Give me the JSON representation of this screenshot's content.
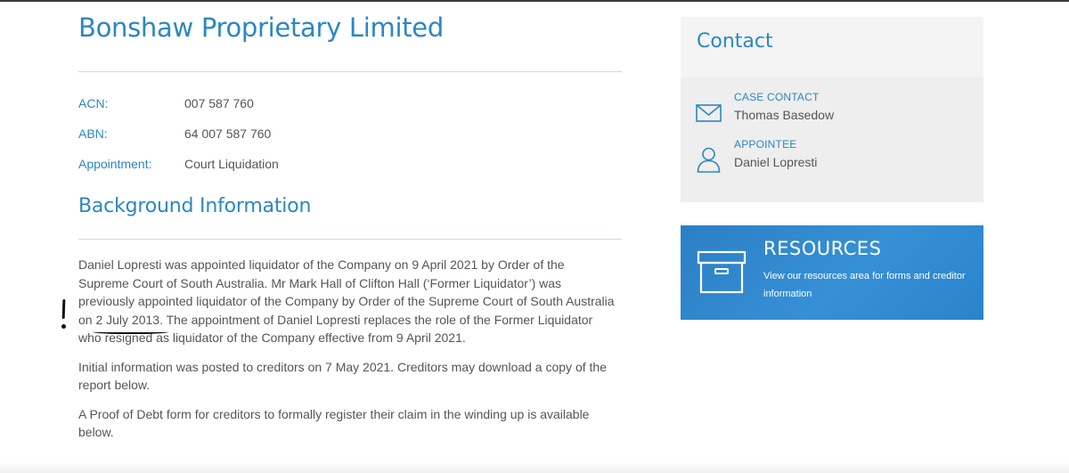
{
  "page": {
    "company_name": "Bonshaw Proprietary Limited",
    "details": [
      {
        "label": "ACN:",
        "value": "007 587 760"
      },
      {
        "label": "ABN:",
        "value": "64 007 587 760"
      },
      {
        "label": "Appointment:",
        "value": "Court Liquidation"
      }
    ],
    "background_heading": "Background Information",
    "paragraphs": {
      "p1_a": "Daniel Lopresti was appointed liquidator of the Company on 9 April 2021 by Order of the Supreme Court of South Australia.  Mr Mark Hall of Clifton Hall (‘Former Liquidator’) was previously appointed liquidator of the Company by Order of the Supreme Court of South Australia on ",
      "p1_date": "2 July 2013.",
      "p1_b": "  The appointment of Daniel Lopresti replaces the role of the Former Liquidator who resigned as liquidator of the Company effective from 9 April 2021.",
      "p2": "Initial information was posted to creditors on 7 May 2021.  Creditors may download a copy of the report below.",
      "p3": "A Proof of Debt form for creditors to formally register their claim in the winding up is available below."
    }
  },
  "contact": {
    "title": "Contact",
    "items": [
      {
        "role": "CASE CONTACT",
        "name": "Thomas Basedow",
        "icon": "envelope-icon"
      },
      {
        "role": "APPOINTEE",
        "name": "Daniel Lopresti",
        "icon": "person-icon"
      }
    ]
  },
  "resources": {
    "title": "RESOURCES",
    "description": "View our resources area for forms and creditor information",
    "icon": "archive-box-icon"
  },
  "colors": {
    "accent": "#2b87c2",
    "body_text": "#555555",
    "resources_bg": "#2f86cc",
    "contact_bg": "#eeeeee"
  }
}
